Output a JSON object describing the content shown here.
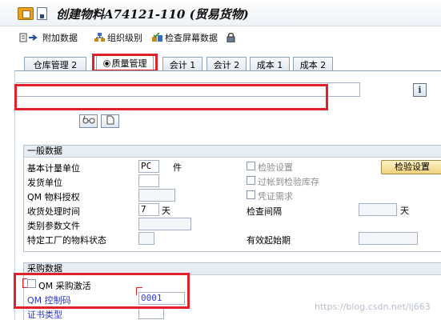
{
  "window": {
    "title": "创建物料A74121-110 (贸易货物)"
  },
  "toolbar": {
    "additional_data": "附加数据",
    "org_levels": "组织级别",
    "check_screen_data": "检查屏幕数据"
  },
  "tabs": [
    {
      "label": "仓库管理 2",
      "active": false
    },
    {
      "label": "质量管理",
      "active": true
    },
    {
      "label": "会计 1",
      "active": false
    },
    {
      "label": "会计 2",
      "active": false
    },
    {
      "label": "成本 1",
      "active": false
    },
    {
      "label": "成本 2",
      "active": false
    }
  ],
  "general": {
    "title": "一般数据",
    "base_uom_label": "基本计量单位",
    "base_uom_value": "PC",
    "base_uom_text": "件",
    "issue_unit_label": "发货单位",
    "qm_auth_label": "QM 物料授权",
    "gr_proc_time_label": "收货处理时间",
    "gr_proc_time_value": "7",
    "gr_proc_time_unit": "天",
    "class_profile_label": "类别参数文件",
    "plant_status_label": "特定工厂的物料状态",
    "insp_setup_label": "检验设置",
    "post_insp_stock_label": "过帐到检验库存",
    "doc_required_label": "凭证需求",
    "insp_interval_label": "检查间隔",
    "insp_interval_unit": "天",
    "valid_from_label": "有效起始期",
    "insp_setup_button": "检验设置"
  },
  "procurement": {
    "title": "采购数据",
    "qm_active_label": "QM 采购激活",
    "qm_active_checked": false,
    "qm_control_key_label": "QM 控制码",
    "qm_control_key_value": "0001",
    "cert_type_label": "证书类型"
  },
  "watermark": "https://blog.csdn.net/lj663",
  "colors": {
    "highlight_red": "#e0202a",
    "label_blue": "#2d39c9",
    "button_gold": "#f1d27b"
  }
}
